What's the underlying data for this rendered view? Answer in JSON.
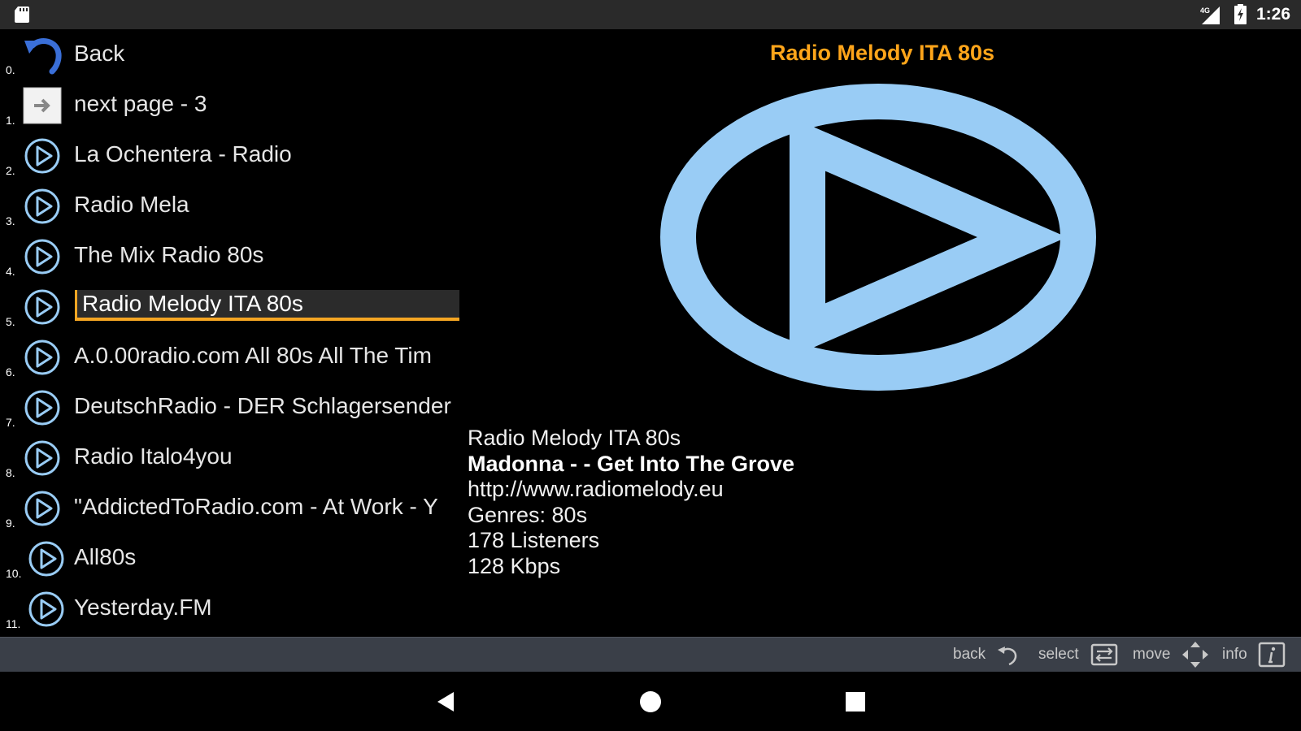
{
  "status_bar": {
    "time": "1:26",
    "network": "4G",
    "icons": [
      "sd-card-icon",
      "signal-icon",
      "battery-icon"
    ]
  },
  "list": {
    "items": [
      {
        "index": "0.",
        "label": "Back",
        "icon": "back-arrow-icon"
      },
      {
        "index": "1.",
        "label": "next page - 3",
        "icon": "next-page-icon"
      },
      {
        "index": "2.",
        "label": "La Ochentera - Radio",
        "icon": "play-circle-icon"
      },
      {
        "index": "3.",
        "label": "Radio Mela",
        "icon": "play-circle-icon"
      },
      {
        "index": "4.",
        "label": "The Mix Radio 80s",
        "icon": "play-circle-icon"
      },
      {
        "index": "5.",
        "label": "Radio Melody ITA 80s",
        "icon": "play-circle-icon",
        "selected": true
      },
      {
        "index": "6.",
        "label": "A.0.00radio.com All 80s All The Tim",
        "icon": "play-circle-icon"
      },
      {
        "index": "7.",
        "label": "DeutschRadio - DER Schlagersender",
        "icon": "play-circle-icon"
      },
      {
        "index": "8.",
        "label": "Radio Italo4you",
        "icon": "play-circle-icon"
      },
      {
        "index": "9.",
        "label": "\"AddictedToRadio.com - At Work - Y",
        "icon": "play-circle-icon"
      },
      {
        "index": "10.",
        "label": "All80s",
        "icon": "play-circle-icon"
      },
      {
        "index": "11.",
        "label": "Yesterday.FM",
        "icon": "play-circle-icon"
      }
    ]
  },
  "detail": {
    "title": "Radio Melody ITA 80s",
    "station_name": "Radio Melody ITA 80s",
    "now_playing": "Madonna - - Get Into The Grove",
    "url": "http://www.radiomelody.eu",
    "genres": "Genres: 80s",
    "listeners": "178 Listeners",
    "bitrate": "128 Kbps",
    "accent_color": "#ffa51a",
    "play_icon_color": "#99ccf5"
  },
  "hints": {
    "back": "back",
    "select": "select",
    "move": "move",
    "info": "info"
  }
}
